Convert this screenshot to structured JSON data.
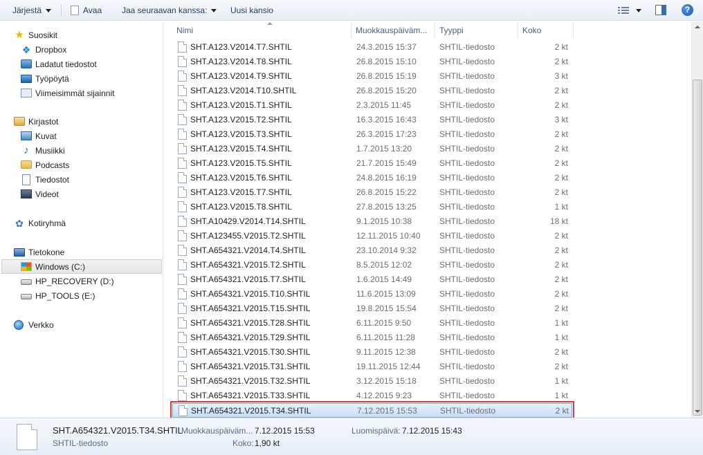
{
  "toolbar": {
    "organize": "Järjestä",
    "open": "Avaa",
    "share_with": "Jaa seuraavan kanssa:",
    "new_folder": "Uusi kansio",
    "help": "?"
  },
  "nav": {
    "favorites": "Suosikit",
    "dropbox": "Dropbox",
    "downloads": "Ladatut tiedostot",
    "desktop": "Työpöytä",
    "recent": "Viimeisimmät sijainnit",
    "libraries": "Kirjastot",
    "pictures": "Kuvat",
    "music": "Musiikki",
    "podcasts": "Podcasts",
    "documents": "Tiedostot",
    "videos": "Videot",
    "homegroup": "Kotiryhmä",
    "computer": "Tietokone",
    "drive_c": "Windows (C:)",
    "drive_d": "HP_RECOVERY (D:)",
    "drive_e": "HP_TOOLS (E:)",
    "network": "Verkko"
  },
  "columns": {
    "name": "Nimi",
    "modified": "Muokkauspäiväm...",
    "type": "Tyyppi",
    "size": "Koko"
  },
  "files": [
    {
      "name": "SHT.A123.V2014.T7.SHTIL",
      "date": "24.3.2015 15:37",
      "type": "SHTIL-tiedosto",
      "size": "2 kt"
    },
    {
      "name": "SHT.A123.V2014.T8.SHTIL",
      "date": "26.8.2015 15:10",
      "type": "SHTIL-tiedosto",
      "size": "2 kt"
    },
    {
      "name": "SHT.A123.V2014.T9.SHTIL",
      "date": "26.8.2015 15:19",
      "type": "SHTIL-tiedosto",
      "size": "3 kt"
    },
    {
      "name": "SHT.A123.V2014.T10.SHTIL",
      "date": "26.8.2015 15:20",
      "type": "SHTIL-tiedosto",
      "size": "2 kt"
    },
    {
      "name": "SHT.A123.V2015.T1.SHTIL",
      "date": "2.3.2015 11:45",
      "type": "SHTIL-tiedosto",
      "size": "2 kt"
    },
    {
      "name": "SHT.A123.V2015.T2.SHTIL",
      "date": "16.3.2015 16:43",
      "type": "SHTIL-tiedosto",
      "size": "3 kt"
    },
    {
      "name": "SHT.A123.V2015.T3.SHTIL",
      "date": "26.3.2015 17:23",
      "type": "SHTIL-tiedosto",
      "size": "2 kt"
    },
    {
      "name": "SHT.A123.V2015.T4.SHTIL",
      "date": "1.7.2015 13:20",
      "type": "SHTIL-tiedosto",
      "size": "2 kt"
    },
    {
      "name": "SHT.A123.V2015.T5.SHTIL",
      "date": "21.7.2015 15:49",
      "type": "SHTIL-tiedosto",
      "size": "2 kt"
    },
    {
      "name": "SHT.A123.V2015.T6.SHTIL",
      "date": "24.8.2015 16:19",
      "type": "SHTIL-tiedosto",
      "size": "2 kt"
    },
    {
      "name": "SHT.A123.V2015.T7.SHTIL",
      "date": "26.8.2015 15:22",
      "type": "SHTIL-tiedosto",
      "size": "2 kt"
    },
    {
      "name": "SHT.A123.V2015.T8.SHTIL",
      "date": "27.8.2015 13:25",
      "type": "SHTIL-tiedosto",
      "size": "1 kt"
    },
    {
      "name": "SHT.A10429.V2014.T14.SHTIL",
      "date": "9.1.2015 10:38",
      "type": "SHTIL-tiedosto",
      "size": "18 kt"
    },
    {
      "name": "SHT.A123455.V2015.T2.SHTIL",
      "date": "12.11.2015 10:40",
      "type": "SHTIL-tiedosto",
      "size": "2 kt"
    },
    {
      "name": "SHT.A654321.V2014.T4.SHTIL",
      "date": "23.10.2014 9:32",
      "type": "SHTIL-tiedosto",
      "size": "2 kt"
    },
    {
      "name": "SHT.A654321.V2015.T2.SHTIL",
      "date": "8.5.2015 12:02",
      "type": "SHTIL-tiedosto",
      "size": "2 kt"
    },
    {
      "name": "SHT.A654321.V2015.T7.SHTIL",
      "date": "1.6.2015 14:49",
      "type": "SHTIL-tiedosto",
      "size": "2 kt"
    },
    {
      "name": "SHT.A654321.V2015.T10.SHTIL",
      "date": "11.6.2015 13:09",
      "type": "SHTIL-tiedosto",
      "size": "2 kt"
    },
    {
      "name": "SHT.A654321.V2015.T15.SHTIL",
      "date": "19.8.2015 15:54",
      "type": "SHTIL-tiedosto",
      "size": "2 kt"
    },
    {
      "name": "SHT.A654321.V2015.T28.SHTIL",
      "date": "6.11.2015 9:50",
      "type": "SHTIL-tiedosto",
      "size": "1 kt"
    },
    {
      "name": "SHT.A654321.V2015.T29.SHTIL",
      "date": "6.11.2015 11:28",
      "type": "SHTIL-tiedosto",
      "size": "1 kt"
    },
    {
      "name": "SHT.A654321.V2015.T30.SHTIL",
      "date": "9.11.2015 12:38",
      "type": "SHTIL-tiedosto",
      "size": "2 kt"
    },
    {
      "name": "SHT.A654321.V2015.T31.SHTIL",
      "date": "19.11.2015 12:44",
      "type": "SHTIL-tiedosto",
      "size": "2 kt"
    },
    {
      "name": "SHT.A654321.V2015.T32.SHTIL",
      "date": "3.12.2015 15:18",
      "type": "SHTIL-tiedosto",
      "size": "1 kt"
    },
    {
      "name": "SHT.A654321.V2015.T33.SHTIL",
      "date": "4.12.2015 9:23",
      "type": "SHTIL-tiedosto",
      "size": "1 kt"
    },
    {
      "name": "SHT.A654321.V2015.T34.SHTIL",
      "date": "7.12.2015 15:53",
      "type": "SHTIL-tiedosto",
      "size": "2 kt",
      "selected": true
    }
  ],
  "details": {
    "filename": "SHT.A654321.V2015.T34.SHTIL",
    "filetype": "SHTIL-tiedosto",
    "modified_label": "Muokkauspäiväm...",
    "modified_value": "7.12.2015 15:53",
    "created_label": "Luomispäivä:",
    "created_value": "7.12.2015 15:43",
    "size_label": "Koko:",
    "size_value": "1,90 kt"
  },
  "colors": {
    "selection_outline": "#e03a3a",
    "selection_fill": "#cce4f9",
    "toolbar_text": "#1e395b"
  }
}
